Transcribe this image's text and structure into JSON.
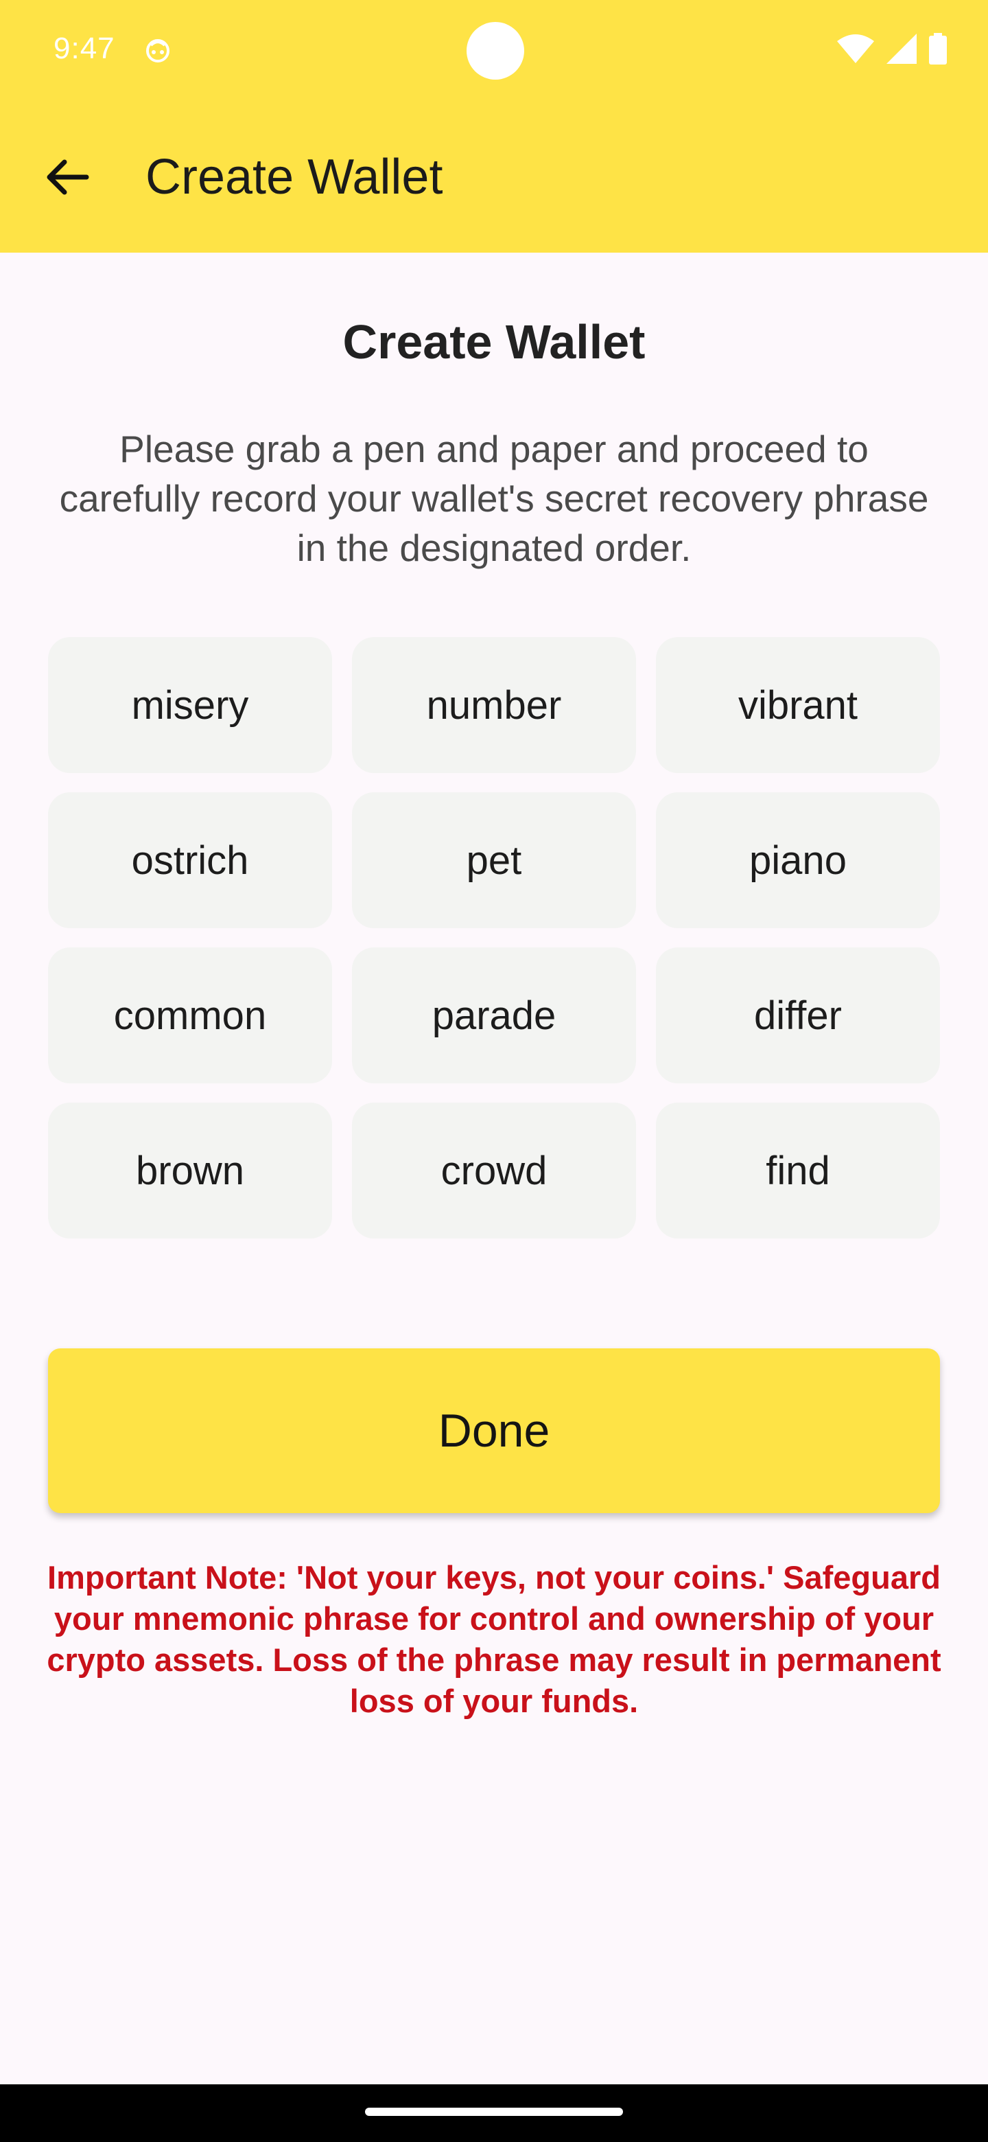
{
  "status_bar": {
    "time": "9:47"
  },
  "app_bar": {
    "title": "Create Wallet"
  },
  "content": {
    "title": "Create Wallet",
    "instructions": "Please grab a pen and paper and proceed to carefully record your wallet's secret recovery phrase in the designated order.",
    "words": [
      "misery",
      "number",
      "vibrant",
      "ostrich",
      "pet",
      "piano",
      "common",
      "parade",
      "differ",
      "brown",
      "crowd",
      "find"
    ],
    "done_label": "Done",
    "note": "Important Note: 'Not your keys, not your coins.' Safeguard your mnemonic phrase for control and ownership of your crypto assets. Loss of the phrase may result in permanent loss of your funds."
  },
  "colors": {
    "accent": "#fee346",
    "note_red": "#c9111a",
    "word_bg": "#f3f4f2",
    "background": "#fdf8fc"
  },
  "icons": {
    "back": "arrow-left-icon",
    "wifi": "wifi-icon",
    "signal": "signal-icon",
    "battery": "battery-icon"
  }
}
